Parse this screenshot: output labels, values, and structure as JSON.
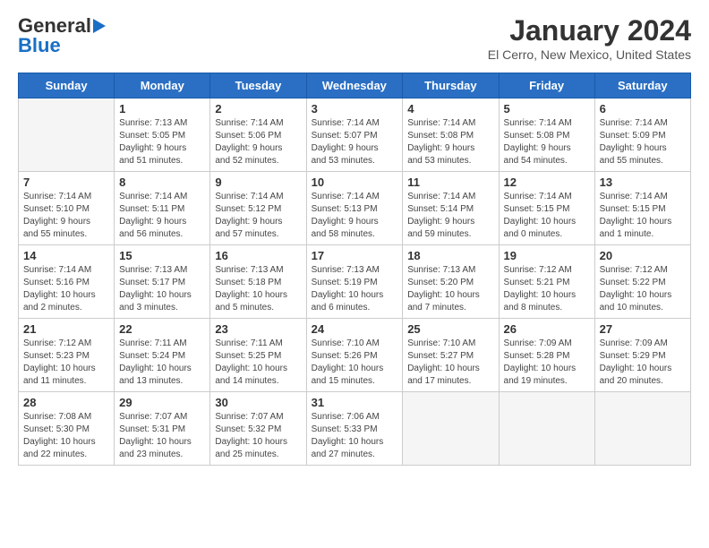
{
  "logo": {
    "general": "General",
    "blue": "Blue"
  },
  "title": "January 2024",
  "location": "El Cerro, New Mexico, United States",
  "days_of_week": [
    "Sunday",
    "Monday",
    "Tuesday",
    "Wednesday",
    "Thursday",
    "Friday",
    "Saturday"
  ],
  "weeks": [
    [
      {
        "day": "",
        "info": ""
      },
      {
        "day": "1",
        "info": "Sunrise: 7:13 AM\nSunset: 5:05 PM\nDaylight: 9 hours\nand 51 minutes."
      },
      {
        "day": "2",
        "info": "Sunrise: 7:14 AM\nSunset: 5:06 PM\nDaylight: 9 hours\nand 52 minutes."
      },
      {
        "day": "3",
        "info": "Sunrise: 7:14 AM\nSunset: 5:07 PM\nDaylight: 9 hours\nand 53 minutes."
      },
      {
        "day": "4",
        "info": "Sunrise: 7:14 AM\nSunset: 5:08 PM\nDaylight: 9 hours\nand 53 minutes."
      },
      {
        "day": "5",
        "info": "Sunrise: 7:14 AM\nSunset: 5:08 PM\nDaylight: 9 hours\nand 54 minutes."
      },
      {
        "day": "6",
        "info": "Sunrise: 7:14 AM\nSunset: 5:09 PM\nDaylight: 9 hours\nand 55 minutes."
      }
    ],
    [
      {
        "day": "7",
        "info": "Sunrise: 7:14 AM\nSunset: 5:10 PM\nDaylight: 9 hours\nand 55 minutes."
      },
      {
        "day": "8",
        "info": "Sunrise: 7:14 AM\nSunset: 5:11 PM\nDaylight: 9 hours\nand 56 minutes."
      },
      {
        "day": "9",
        "info": "Sunrise: 7:14 AM\nSunset: 5:12 PM\nDaylight: 9 hours\nand 57 minutes."
      },
      {
        "day": "10",
        "info": "Sunrise: 7:14 AM\nSunset: 5:13 PM\nDaylight: 9 hours\nand 58 minutes."
      },
      {
        "day": "11",
        "info": "Sunrise: 7:14 AM\nSunset: 5:14 PM\nDaylight: 9 hours\nand 59 minutes."
      },
      {
        "day": "12",
        "info": "Sunrise: 7:14 AM\nSunset: 5:15 PM\nDaylight: 10 hours\nand 0 minutes."
      },
      {
        "day": "13",
        "info": "Sunrise: 7:14 AM\nSunset: 5:15 PM\nDaylight: 10 hours\nand 1 minute."
      }
    ],
    [
      {
        "day": "14",
        "info": "Sunrise: 7:14 AM\nSunset: 5:16 PM\nDaylight: 10 hours\nand 2 minutes."
      },
      {
        "day": "15",
        "info": "Sunrise: 7:13 AM\nSunset: 5:17 PM\nDaylight: 10 hours\nand 3 minutes."
      },
      {
        "day": "16",
        "info": "Sunrise: 7:13 AM\nSunset: 5:18 PM\nDaylight: 10 hours\nand 5 minutes."
      },
      {
        "day": "17",
        "info": "Sunrise: 7:13 AM\nSunset: 5:19 PM\nDaylight: 10 hours\nand 6 minutes."
      },
      {
        "day": "18",
        "info": "Sunrise: 7:13 AM\nSunset: 5:20 PM\nDaylight: 10 hours\nand 7 minutes."
      },
      {
        "day": "19",
        "info": "Sunrise: 7:12 AM\nSunset: 5:21 PM\nDaylight: 10 hours\nand 8 minutes."
      },
      {
        "day": "20",
        "info": "Sunrise: 7:12 AM\nSunset: 5:22 PM\nDaylight: 10 hours\nand 10 minutes."
      }
    ],
    [
      {
        "day": "21",
        "info": "Sunrise: 7:12 AM\nSunset: 5:23 PM\nDaylight: 10 hours\nand 11 minutes."
      },
      {
        "day": "22",
        "info": "Sunrise: 7:11 AM\nSunset: 5:24 PM\nDaylight: 10 hours\nand 13 minutes."
      },
      {
        "day": "23",
        "info": "Sunrise: 7:11 AM\nSunset: 5:25 PM\nDaylight: 10 hours\nand 14 minutes."
      },
      {
        "day": "24",
        "info": "Sunrise: 7:10 AM\nSunset: 5:26 PM\nDaylight: 10 hours\nand 15 minutes."
      },
      {
        "day": "25",
        "info": "Sunrise: 7:10 AM\nSunset: 5:27 PM\nDaylight: 10 hours\nand 17 minutes."
      },
      {
        "day": "26",
        "info": "Sunrise: 7:09 AM\nSunset: 5:28 PM\nDaylight: 10 hours\nand 19 minutes."
      },
      {
        "day": "27",
        "info": "Sunrise: 7:09 AM\nSunset: 5:29 PM\nDaylight: 10 hours\nand 20 minutes."
      }
    ],
    [
      {
        "day": "28",
        "info": "Sunrise: 7:08 AM\nSunset: 5:30 PM\nDaylight: 10 hours\nand 22 minutes."
      },
      {
        "day": "29",
        "info": "Sunrise: 7:07 AM\nSunset: 5:31 PM\nDaylight: 10 hours\nand 23 minutes."
      },
      {
        "day": "30",
        "info": "Sunrise: 7:07 AM\nSunset: 5:32 PM\nDaylight: 10 hours\nand 25 minutes."
      },
      {
        "day": "31",
        "info": "Sunrise: 7:06 AM\nSunset: 5:33 PM\nDaylight: 10 hours\nand 27 minutes."
      },
      {
        "day": "",
        "info": ""
      },
      {
        "day": "",
        "info": ""
      },
      {
        "day": "",
        "info": ""
      }
    ]
  ]
}
